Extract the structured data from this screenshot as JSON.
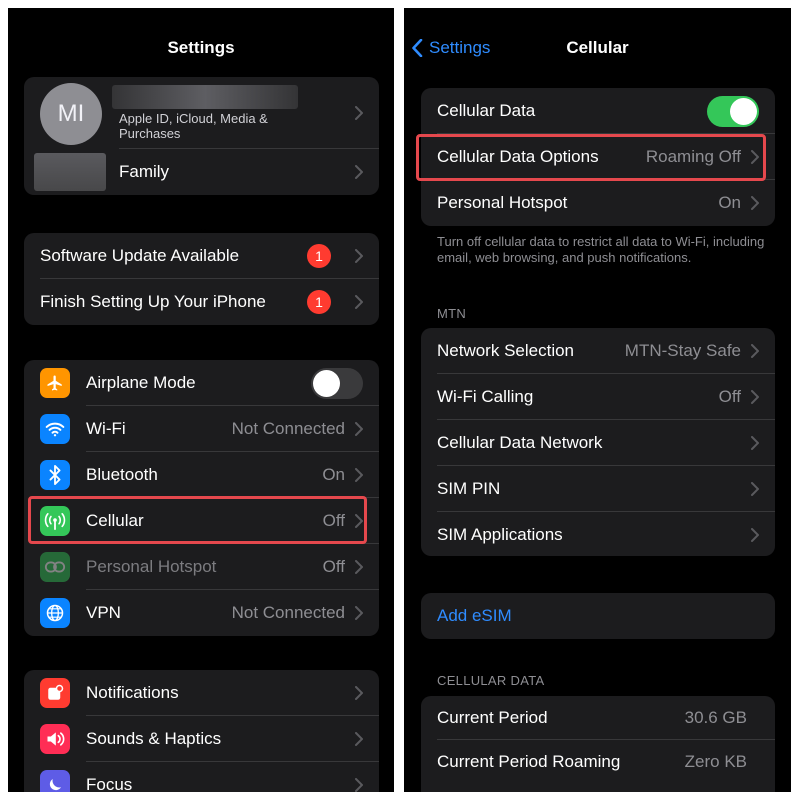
{
  "left": {
    "title": "Settings",
    "profile": {
      "initials": "MI",
      "subtitle": "Apple ID, iCloud, Media & Purchases",
      "family_label": "Family"
    },
    "updates": [
      {
        "label": "Software Update Available",
        "badge": "1"
      },
      {
        "label": "Finish Setting Up Your iPhone",
        "badge": "1"
      }
    ],
    "connectivity": [
      {
        "label": "Airplane Mode",
        "value": "",
        "icon": "airplane-icon",
        "color": "#ff9500",
        "toggle": false
      },
      {
        "label": "Wi-Fi",
        "value": "Not Connected",
        "icon": "wifi-icon",
        "color": "#0a84ff"
      },
      {
        "label": "Bluetooth",
        "value": "On",
        "icon": "bluetooth-icon",
        "color": "#0a84ff"
      },
      {
        "label": "Cellular",
        "value": "Off",
        "icon": "cellular-icon",
        "color": "#34c759"
      },
      {
        "label": "Personal Hotspot",
        "value": "Off",
        "icon": "hotspot-icon",
        "color": "#34c759",
        "dimmed": true
      },
      {
        "label": "VPN",
        "value": "Not Connected",
        "icon": "vpn-globe-icon",
        "color": "#0a84ff"
      }
    ],
    "general": [
      {
        "label": "Notifications",
        "icon": "notifications-icon",
        "color": "#ff3b30"
      },
      {
        "label": "Sounds & Haptics",
        "icon": "speaker-icon",
        "color": "#ff2d55"
      },
      {
        "label": "Focus",
        "icon": "moon-icon",
        "color": "#5e5ce6"
      }
    ]
  },
  "right": {
    "back_label": "Settings",
    "title": "Cellular",
    "cellular_data": {
      "label": "Cellular Data",
      "toggle": true
    },
    "data_options": {
      "label": "Cellular Data Options",
      "value": "Roaming Off"
    },
    "hotspot": {
      "label": "Personal Hotspot",
      "value": "On"
    },
    "footnote": "Turn off cellular data to restrict all data to Wi-Fi, including email, web browsing, and push notifications.",
    "carrier_header": "MTN",
    "carrier_rows": [
      {
        "label": "Network Selection",
        "value": "MTN-Stay Safe"
      },
      {
        "label": "Wi-Fi Calling",
        "value": "Off"
      },
      {
        "label": "Cellular Data Network",
        "value": ""
      },
      {
        "label": "SIM PIN",
        "value": ""
      },
      {
        "label": "SIM Applications",
        "value": ""
      }
    ],
    "add_esim": "Add eSIM",
    "usage_header": "CELLULAR DATA",
    "usage_rows": [
      {
        "label": "Current Period",
        "value": "30.6 GB"
      },
      {
        "label": "Current Period Roaming",
        "value": "Zero KB"
      }
    ]
  },
  "colors": {
    "highlight": "#e5484d",
    "accent_blue": "#2f8cff",
    "toggle_on": "#34c759"
  }
}
